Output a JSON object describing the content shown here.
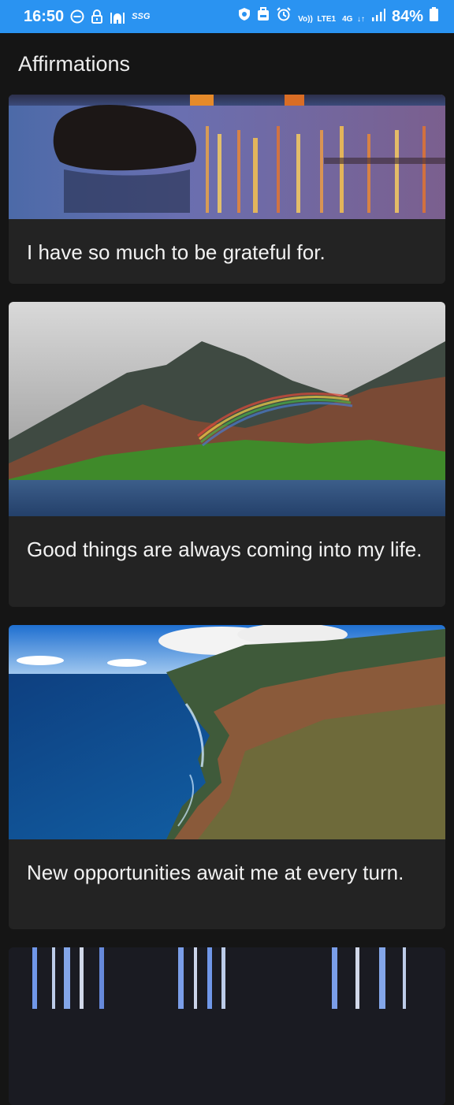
{
  "status_bar": {
    "time": "16:50",
    "left_icons": [
      "do-not-disturb-icon",
      "lock-icon",
      "mosque-icon",
      "ssg-icon"
    ],
    "ssg_text": "SSG",
    "volte_text_top": "Vo))",
    "volte_text_bottom": "LTE1",
    "network_text": "4G",
    "battery": "84%",
    "right_icons": [
      "shield-app-icon",
      "backpack-icon",
      "alarm-icon",
      "volte-icon",
      "network-4g-icon",
      "signal-icon",
      "battery-icon"
    ]
  },
  "app": {
    "title": "Affirmations"
  },
  "cards": [
    {
      "text": "I have so much to be grateful for.",
      "image": "sunset-beach-rock-icon"
    },
    {
      "text": "Good things are always coming into my life.",
      "image": "mountain-rainbow-icon"
    },
    {
      "text": "New opportunities await me at every turn.",
      "image": "coastline-cliffs-icon"
    },
    {
      "text": "",
      "image": "light-streaks-icon"
    }
  ],
  "colors": {
    "status_bar": "#2a93f1",
    "background": "#151515",
    "card": "#232323",
    "text": "#f2f2f2"
  }
}
